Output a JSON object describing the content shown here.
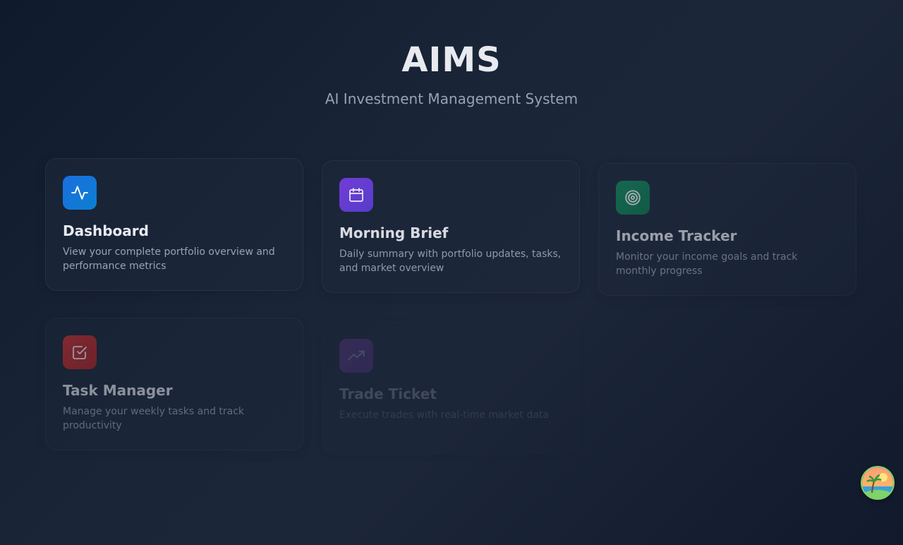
{
  "app": {
    "title": "AIMS",
    "subtitle": "AI Investment Management System"
  },
  "cards": [
    {
      "title": "Dashboard",
      "description": "View your complete portfolio overview and performance metrics",
      "icon": "activity-icon",
      "color": "#1a6fe0"
    },
    {
      "title": "Morning Brief",
      "description": "Daily summary with portfolio updates, tasks, and market overview",
      "icon": "calendar-icon",
      "color": "#7b3fe4"
    },
    {
      "title": "Income Tracker",
      "description": "Monitor your income goals and track monthly progress",
      "icon": "target-icon",
      "color": "#149060"
    },
    {
      "title": "Task Manager",
      "description": "Manage your weekly tasks and track productivity",
      "icon": "checkbox-icon",
      "color": "#d93030"
    },
    {
      "title": "Trade Ticket",
      "description": "Execute trades with real-time market data",
      "icon": "trending-up-icon",
      "color": "#b14fe0"
    }
  ],
  "user": {
    "avatar_icon": "beach-avatar-icon"
  }
}
